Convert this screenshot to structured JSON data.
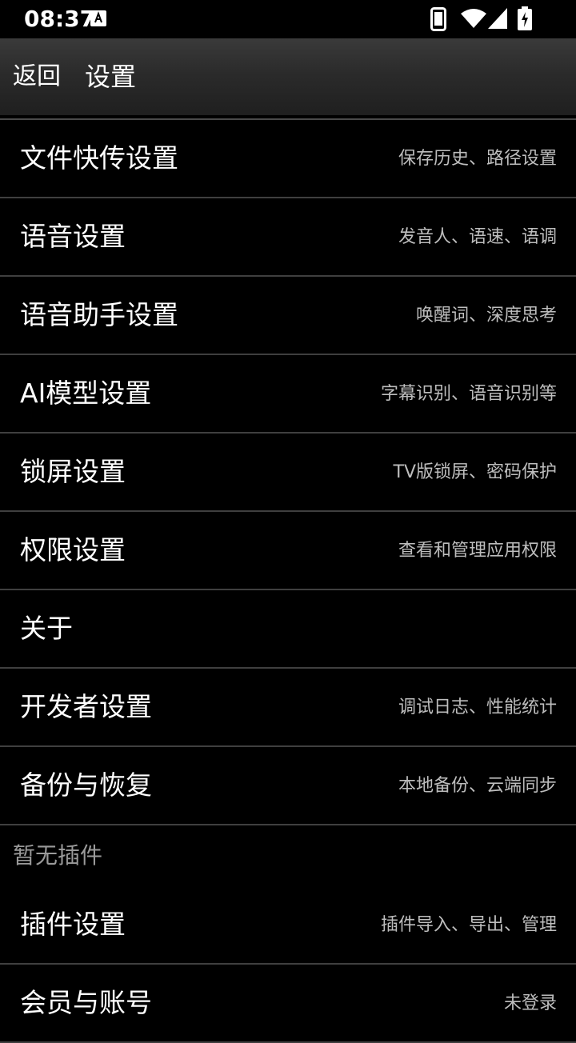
{
  "status_bar": {
    "time": "08:37",
    "icons": [
      "accessibility-a-icon",
      "phone-icon",
      "wifi-icon",
      "cell-signal-icon",
      "battery-charging-icon"
    ]
  },
  "action_bar": {
    "back_label": "返回",
    "title": "设置"
  },
  "settings": {
    "items": [
      {
        "title": "文件快传设置",
        "subtitle": "保存历史、路径设置"
      },
      {
        "title": "语音设置",
        "subtitle": "发音人、语速、语调"
      },
      {
        "title": "语音助手设置",
        "subtitle": "唤醒词、深度思考"
      },
      {
        "title": "AI模型设置",
        "subtitle": "字幕识别、语音识别等"
      },
      {
        "title": "锁屏设置",
        "subtitle": "TV版锁屏、密码保护"
      },
      {
        "title": "权限设置",
        "subtitle": "查看和管理应用权限"
      },
      {
        "title": "关于",
        "subtitle": ""
      },
      {
        "title": "开发者设置",
        "subtitle": "调试日志、性能统计"
      },
      {
        "title": "备份与恢复",
        "subtitle": "本地备份、云端同步"
      }
    ],
    "plugins_header": "暂无插件",
    "extra_items": [
      {
        "title": "插件设置",
        "subtitle": "插件导入、导出、管理"
      },
      {
        "title": "会员与账号",
        "subtitle": "未登录"
      }
    ]
  }
}
